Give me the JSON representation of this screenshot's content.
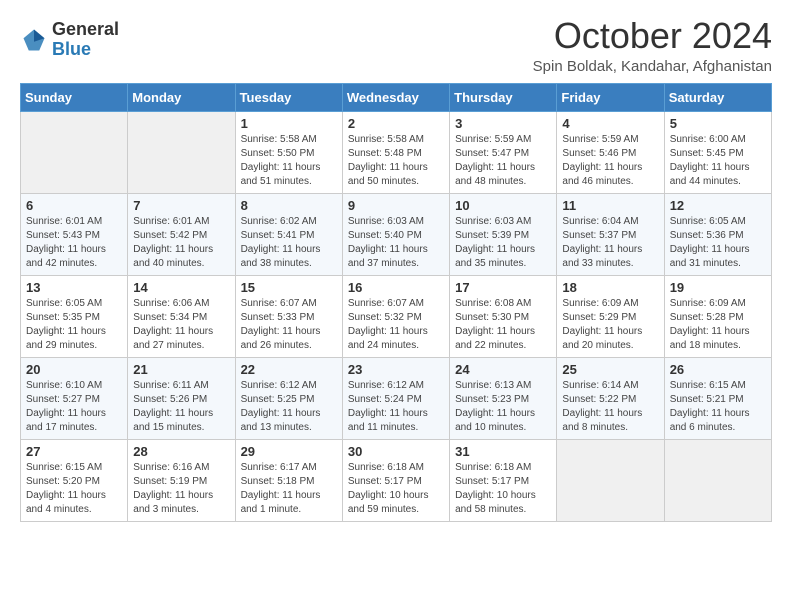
{
  "header": {
    "logo_general": "General",
    "logo_blue": "Blue",
    "month_title": "October 2024",
    "location": "Spin Boldak, Kandahar, Afghanistan"
  },
  "days_of_week": [
    "Sunday",
    "Monday",
    "Tuesday",
    "Wednesday",
    "Thursday",
    "Friday",
    "Saturday"
  ],
  "weeks": [
    [
      {
        "day": "",
        "sunrise": "",
        "sunset": "",
        "daylight": "",
        "empty": true
      },
      {
        "day": "",
        "sunrise": "",
        "sunset": "",
        "daylight": "",
        "empty": true
      },
      {
        "day": "1",
        "sunrise": "Sunrise: 5:58 AM",
        "sunset": "Sunset: 5:50 PM",
        "daylight": "Daylight: 11 hours and 51 minutes.",
        "empty": false
      },
      {
        "day": "2",
        "sunrise": "Sunrise: 5:58 AM",
        "sunset": "Sunset: 5:48 PM",
        "daylight": "Daylight: 11 hours and 50 minutes.",
        "empty": false
      },
      {
        "day": "3",
        "sunrise": "Sunrise: 5:59 AM",
        "sunset": "Sunset: 5:47 PM",
        "daylight": "Daylight: 11 hours and 48 minutes.",
        "empty": false
      },
      {
        "day": "4",
        "sunrise": "Sunrise: 5:59 AM",
        "sunset": "Sunset: 5:46 PM",
        "daylight": "Daylight: 11 hours and 46 minutes.",
        "empty": false
      },
      {
        "day": "5",
        "sunrise": "Sunrise: 6:00 AM",
        "sunset": "Sunset: 5:45 PM",
        "daylight": "Daylight: 11 hours and 44 minutes.",
        "empty": false
      }
    ],
    [
      {
        "day": "6",
        "sunrise": "Sunrise: 6:01 AM",
        "sunset": "Sunset: 5:43 PM",
        "daylight": "Daylight: 11 hours and 42 minutes.",
        "empty": false
      },
      {
        "day": "7",
        "sunrise": "Sunrise: 6:01 AM",
        "sunset": "Sunset: 5:42 PM",
        "daylight": "Daylight: 11 hours and 40 minutes.",
        "empty": false
      },
      {
        "day": "8",
        "sunrise": "Sunrise: 6:02 AM",
        "sunset": "Sunset: 5:41 PM",
        "daylight": "Daylight: 11 hours and 38 minutes.",
        "empty": false
      },
      {
        "day": "9",
        "sunrise": "Sunrise: 6:03 AM",
        "sunset": "Sunset: 5:40 PM",
        "daylight": "Daylight: 11 hours and 37 minutes.",
        "empty": false
      },
      {
        "day": "10",
        "sunrise": "Sunrise: 6:03 AM",
        "sunset": "Sunset: 5:39 PM",
        "daylight": "Daylight: 11 hours and 35 minutes.",
        "empty": false
      },
      {
        "day": "11",
        "sunrise": "Sunrise: 6:04 AM",
        "sunset": "Sunset: 5:37 PM",
        "daylight": "Daylight: 11 hours and 33 minutes.",
        "empty": false
      },
      {
        "day": "12",
        "sunrise": "Sunrise: 6:05 AM",
        "sunset": "Sunset: 5:36 PM",
        "daylight": "Daylight: 11 hours and 31 minutes.",
        "empty": false
      }
    ],
    [
      {
        "day": "13",
        "sunrise": "Sunrise: 6:05 AM",
        "sunset": "Sunset: 5:35 PM",
        "daylight": "Daylight: 11 hours and 29 minutes.",
        "empty": false
      },
      {
        "day": "14",
        "sunrise": "Sunrise: 6:06 AM",
        "sunset": "Sunset: 5:34 PM",
        "daylight": "Daylight: 11 hours and 27 minutes.",
        "empty": false
      },
      {
        "day": "15",
        "sunrise": "Sunrise: 6:07 AM",
        "sunset": "Sunset: 5:33 PM",
        "daylight": "Daylight: 11 hours and 26 minutes.",
        "empty": false
      },
      {
        "day": "16",
        "sunrise": "Sunrise: 6:07 AM",
        "sunset": "Sunset: 5:32 PM",
        "daylight": "Daylight: 11 hours and 24 minutes.",
        "empty": false
      },
      {
        "day": "17",
        "sunrise": "Sunrise: 6:08 AM",
        "sunset": "Sunset: 5:30 PM",
        "daylight": "Daylight: 11 hours and 22 minutes.",
        "empty": false
      },
      {
        "day": "18",
        "sunrise": "Sunrise: 6:09 AM",
        "sunset": "Sunset: 5:29 PM",
        "daylight": "Daylight: 11 hours and 20 minutes.",
        "empty": false
      },
      {
        "day": "19",
        "sunrise": "Sunrise: 6:09 AM",
        "sunset": "Sunset: 5:28 PM",
        "daylight": "Daylight: 11 hours and 18 minutes.",
        "empty": false
      }
    ],
    [
      {
        "day": "20",
        "sunrise": "Sunrise: 6:10 AM",
        "sunset": "Sunset: 5:27 PM",
        "daylight": "Daylight: 11 hours and 17 minutes.",
        "empty": false
      },
      {
        "day": "21",
        "sunrise": "Sunrise: 6:11 AM",
        "sunset": "Sunset: 5:26 PM",
        "daylight": "Daylight: 11 hours and 15 minutes.",
        "empty": false
      },
      {
        "day": "22",
        "sunrise": "Sunrise: 6:12 AM",
        "sunset": "Sunset: 5:25 PM",
        "daylight": "Daylight: 11 hours and 13 minutes.",
        "empty": false
      },
      {
        "day": "23",
        "sunrise": "Sunrise: 6:12 AM",
        "sunset": "Sunset: 5:24 PM",
        "daylight": "Daylight: 11 hours and 11 minutes.",
        "empty": false
      },
      {
        "day": "24",
        "sunrise": "Sunrise: 6:13 AM",
        "sunset": "Sunset: 5:23 PM",
        "daylight": "Daylight: 11 hours and 10 minutes.",
        "empty": false
      },
      {
        "day": "25",
        "sunrise": "Sunrise: 6:14 AM",
        "sunset": "Sunset: 5:22 PM",
        "daylight": "Daylight: 11 hours and 8 minutes.",
        "empty": false
      },
      {
        "day": "26",
        "sunrise": "Sunrise: 6:15 AM",
        "sunset": "Sunset: 5:21 PM",
        "daylight": "Daylight: 11 hours and 6 minutes.",
        "empty": false
      }
    ],
    [
      {
        "day": "27",
        "sunrise": "Sunrise: 6:15 AM",
        "sunset": "Sunset: 5:20 PM",
        "daylight": "Daylight: 11 hours and 4 minutes.",
        "empty": false
      },
      {
        "day": "28",
        "sunrise": "Sunrise: 6:16 AM",
        "sunset": "Sunset: 5:19 PM",
        "daylight": "Daylight: 11 hours and 3 minutes.",
        "empty": false
      },
      {
        "day": "29",
        "sunrise": "Sunrise: 6:17 AM",
        "sunset": "Sunset: 5:18 PM",
        "daylight": "Daylight: 11 hours and 1 minute.",
        "empty": false
      },
      {
        "day": "30",
        "sunrise": "Sunrise: 6:18 AM",
        "sunset": "Sunset: 5:17 PM",
        "daylight": "Daylight: 10 hours and 59 minutes.",
        "empty": false
      },
      {
        "day": "31",
        "sunrise": "Sunrise: 6:18 AM",
        "sunset": "Sunset: 5:17 PM",
        "daylight": "Daylight: 10 hours and 58 minutes.",
        "empty": false
      },
      {
        "day": "",
        "sunrise": "",
        "sunset": "",
        "daylight": "",
        "empty": true
      },
      {
        "day": "",
        "sunrise": "",
        "sunset": "",
        "daylight": "",
        "empty": true
      }
    ]
  ]
}
